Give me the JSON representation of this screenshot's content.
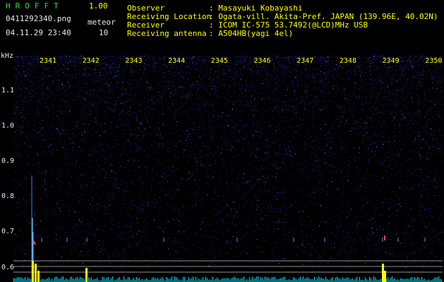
{
  "header": {
    "brand": "HROFFT",
    "version": "1.00",
    "filename": "0411292340.png",
    "timestamp": "04.11.29 23:40",
    "meteor_label": "meteor",
    "meteor_count": "10"
  },
  "info": [
    {
      "key": "Observer",
      "value": ": Masayuki Kobayashi"
    },
    {
      "key": "Receiving Location",
      "value": ": Ogata-vill. Akita-Pref. JAPAN (139.96E, 40.02N)"
    },
    {
      "key": "Receiver",
      "value": ": ICOM IC-575 53.7492(@LCD)MHz USB"
    },
    {
      "key": "Receiving antenna",
      "value": ": A504HB(yagi 4el)"
    }
  ],
  "axis": {
    "unit": "kHz",
    "y_ticks": [
      "1.1",
      "1.0",
      "0.9",
      "0.8",
      "0.7",
      "0.6"
    ],
    "x_ticks": [
      "2341",
      "2342",
      "2343",
      "2344",
      "2345",
      "2346",
      "2347",
      "2348",
      "2349",
      "2350"
    ]
  },
  "colors": {
    "background": "#000000",
    "header_text": "#22e02a",
    "axis_text": "#ffff00",
    "noise": "#2828b4",
    "signal": "#ffff00",
    "echo": "#ff4060"
  }
}
